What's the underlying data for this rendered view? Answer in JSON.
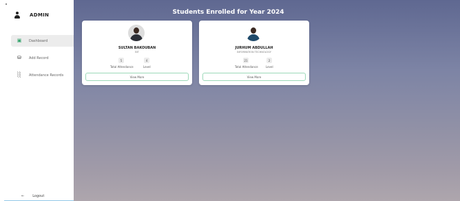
{
  "sidebar": {
    "title": "ADMIN",
    "items": [
      {
        "label": "Dashboard",
        "icon": "dashboard-icon",
        "active": true
      },
      {
        "label": "Add Record",
        "icon": "database-icon",
        "active": false
      },
      {
        "label": "Attendance Records",
        "icon": "chart-icon",
        "active": false
      }
    ],
    "logout_label": "Logout"
  },
  "main": {
    "title": "Students Enrolled for Year 2024",
    "students": [
      {
        "name": "SULTAN BAKOUBAN",
        "department": "BIT",
        "total_attendance": "5",
        "level": "4",
        "total_attendance_label": "Total Attendance",
        "level_label": "Level",
        "button_label": "View More"
      },
      {
        "name": "JURHUM ABDULLAH",
        "department": "INFORMATION TECHNOLOGY",
        "total_attendance": "21",
        "level": "2",
        "total_attendance_label": "Total Attendance",
        "level_label": "Level",
        "button_label": "View More"
      }
    ]
  },
  "colors": {
    "accent": "#33a36b",
    "main_bg_top": "#5f6891",
    "main_bg_bottom": "#aea6ad"
  }
}
